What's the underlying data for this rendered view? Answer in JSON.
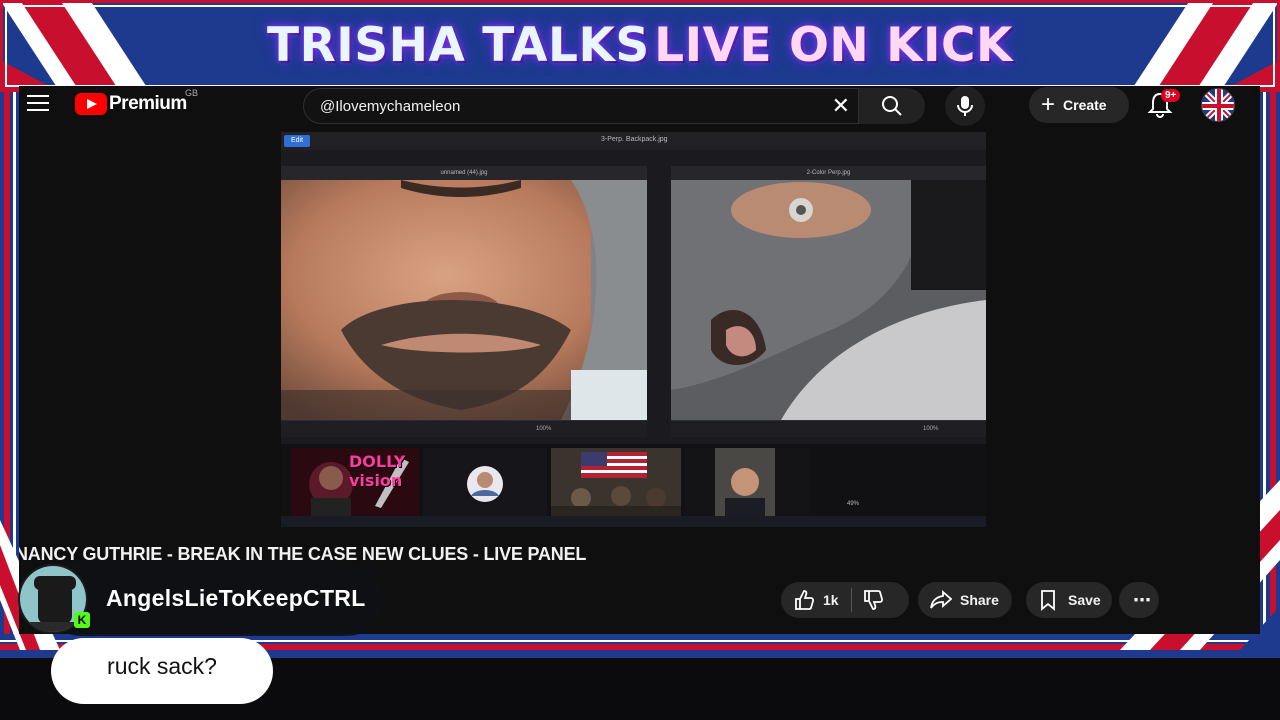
{
  "banner": {
    "title_part1": "TRISHA TALKS",
    "title_part2": "LIVE ON KICK"
  },
  "youtube": {
    "logo_text": "Premium",
    "region": "GB",
    "search_value": "@Ilovemychameleon",
    "create_label": "Create",
    "notification_count": "9+",
    "video_title": "NANCY GUTHRIE - BREAK IN THE CASE NEW CLUES - LIVE PANEL",
    "like_count": "1k",
    "share_label": "Share",
    "save_label": "Save"
  },
  "screen_share": {
    "edit_label": "Edit",
    "main_file": "3-Perp. Backpack.jpg",
    "left_file": "unnamed (44).jpg",
    "right_file": "2-Color Perp.jpg",
    "zoom_left": "100%",
    "zoom_right": "100%",
    "zoom_small": "49%",
    "thumb_label": "DOLLY vision"
  },
  "chat": {
    "username": "AngelsLieToKeepCTRL",
    "message": "ruck sack?"
  },
  "colors": {
    "banner_blue": "#1d3a8f",
    "banner_red": "#c8102e",
    "kick_green": "#53fc18",
    "yt_red": "#ff0000"
  }
}
